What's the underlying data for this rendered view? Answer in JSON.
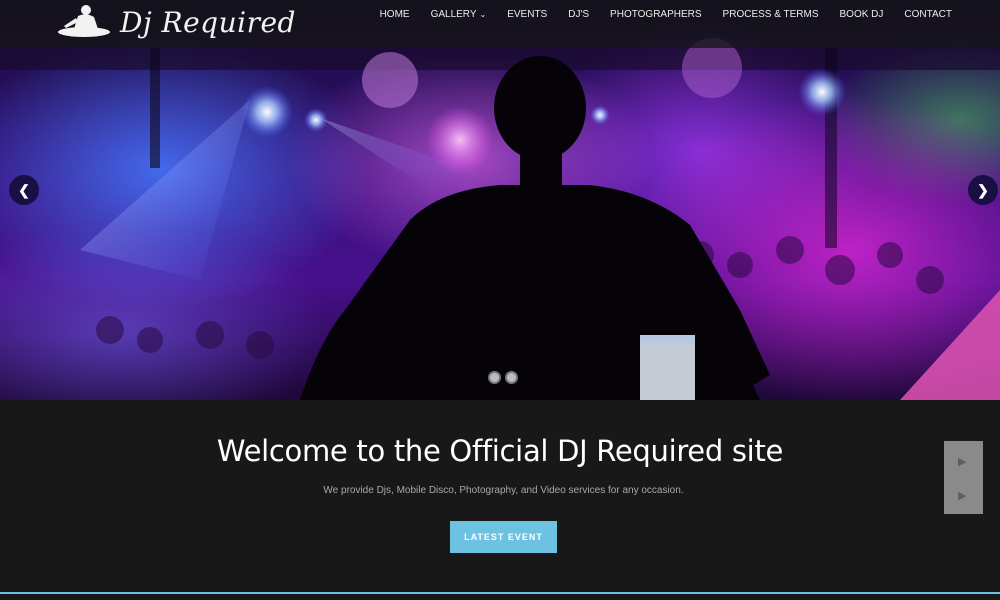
{
  "brand": {
    "logo_text": "Dj Required",
    "logo_icon": "dj-turntable-icon"
  },
  "nav": {
    "items": [
      {
        "label": "HOME"
      },
      {
        "label": "GALLERY",
        "has_dropdown": true
      },
      {
        "label": "EVENTS"
      },
      {
        "label": "DJ'S"
      },
      {
        "label": "PHOTOGRAPHERS"
      },
      {
        "label": "PROCESS & TERMS"
      },
      {
        "label": "BOOK DJ"
      },
      {
        "label": "CONTACT"
      }
    ]
  },
  "slider": {
    "prev_icon": "chevron-left-icon",
    "next_icon": "chevron-right-icon",
    "slide_count": 2
  },
  "welcome": {
    "title": "Welcome to the Official DJ Required site",
    "subtitle": "We provide Djs, Mobile Disco, Photography, and Video services for any occasion.",
    "button_label": "LATEST EVENT"
  },
  "colors": {
    "accent": "#6cc3e1",
    "background": "#181818",
    "navbar": "#141414"
  }
}
